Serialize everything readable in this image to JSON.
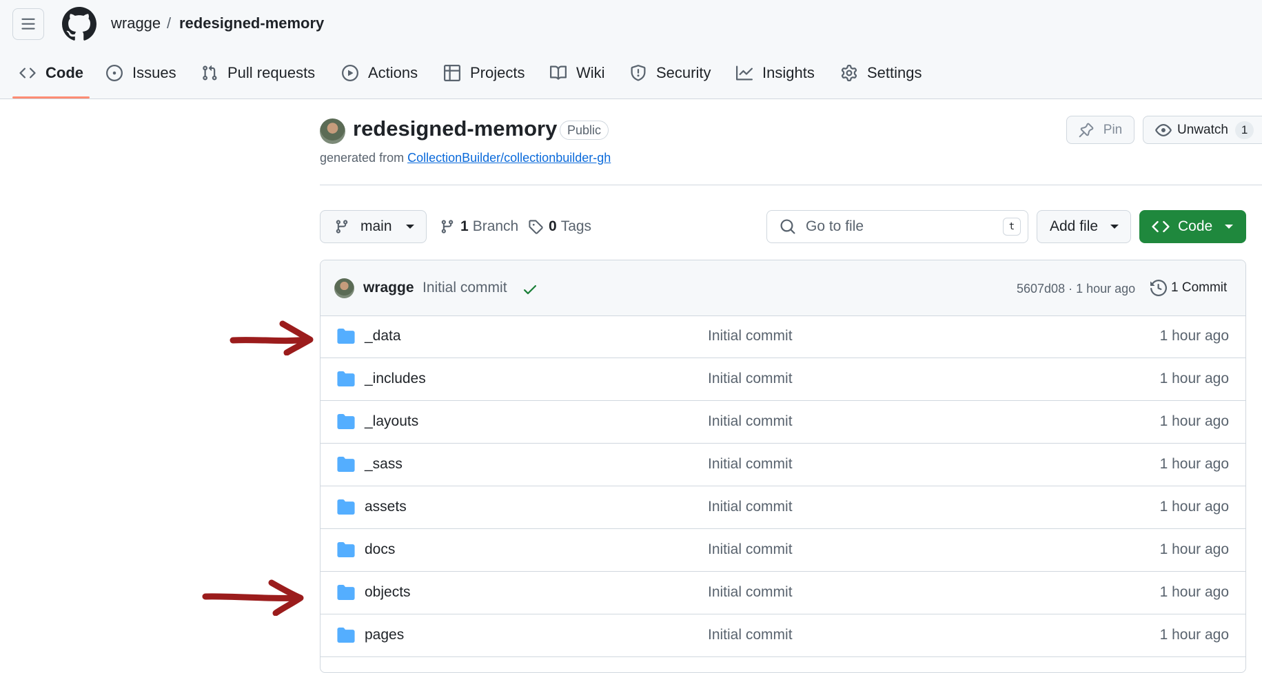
{
  "breadcrumb": {
    "owner": "wragge",
    "separator": "/",
    "repo": "redesigned-memory"
  },
  "nav_tabs": [
    {
      "label": "Code",
      "icon": "code-icon",
      "active": true
    },
    {
      "label": "Issues",
      "icon": "issue-opened-icon"
    },
    {
      "label": "Pull requests",
      "icon": "git-pull-request-icon"
    },
    {
      "label": "Actions",
      "icon": "play-icon"
    },
    {
      "label": "Projects",
      "icon": "table-icon"
    },
    {
      "label": "Wiki",
      "icon": "book-icon"
    },
    {
      "label": "Security",
      "icon": "shield-icon"
    },
    {
      "label": "Insights",
      "icon": "graph-icon"
    },
    {
      "label": "Settings",
      "icon": "gear-icon"
    }
  ],
  "repo": {
    "name": "redesigned-memory",
    "visibility": "Public",
    "generated_prefix": "generated from",
    "template_link": "CollectionBuilder/collectionbuilder-gh"
  },
  "actions": {
    "pin_label": "Pin",
    "watch_label": "Unwatch",
    "watch_count": "1"
  },
  "toolbar": {
    "branch": "main",
    "branch_count": "1",
    "branch_label": "Branch",
    "tag_count": "0",
    "tag_label": "Tags",
    "search_placeholder": "Go to file",
    "search_shortcut": "t",
    "add_file_label": "Add file",
    "code_label": "Code"
  },
  "latest_commit": {
    "author": "wragge",
    "message": "Initial commit",
    "status": "success",
    "meta": "5607d08 · 1 hour ago",
    "history_label": "1 Commit"
  },
  "files": [
    {
      "name": "_data",
      "commit": "Initial commit",
      "age": "1 hour ago"
    },
    {
      "name": "_includes",
      "commit": "Initial commit",
      "age": "1 hour ago"
    },
    {
      "name": "_layouts",
      "commit": "Initial commit",
      "age": "1 hour ago"
    },
    {
      "name": "_sass",
      "commit": "Initial commit",
      "age": "1 hour ago"
    },
    {
      "name": "assets",
      "commit": "Initial commit",
      "age": "1 hour ago"
    },
    {
      "name": "docs",
      "commit": "Initial commit",
      "age": "1 hour ago"
    },
    {
      "name": "objects",
      "commit": "Initial commit",
      "age": "1 hour ago"
    },
    {
      "name": "pages",
      "commit": "Initial commit",
      "age": "1 hour ago"
    }
  ],
  "colors": {
    "accent_green": "#1f883d",
    "link_blue": "#0969da",
    "folder_blue": "#54aeff",
    "active_tab_underline": "#fd8c73",
    "annotation_arrow": "#9b1c1c"
  }
}
